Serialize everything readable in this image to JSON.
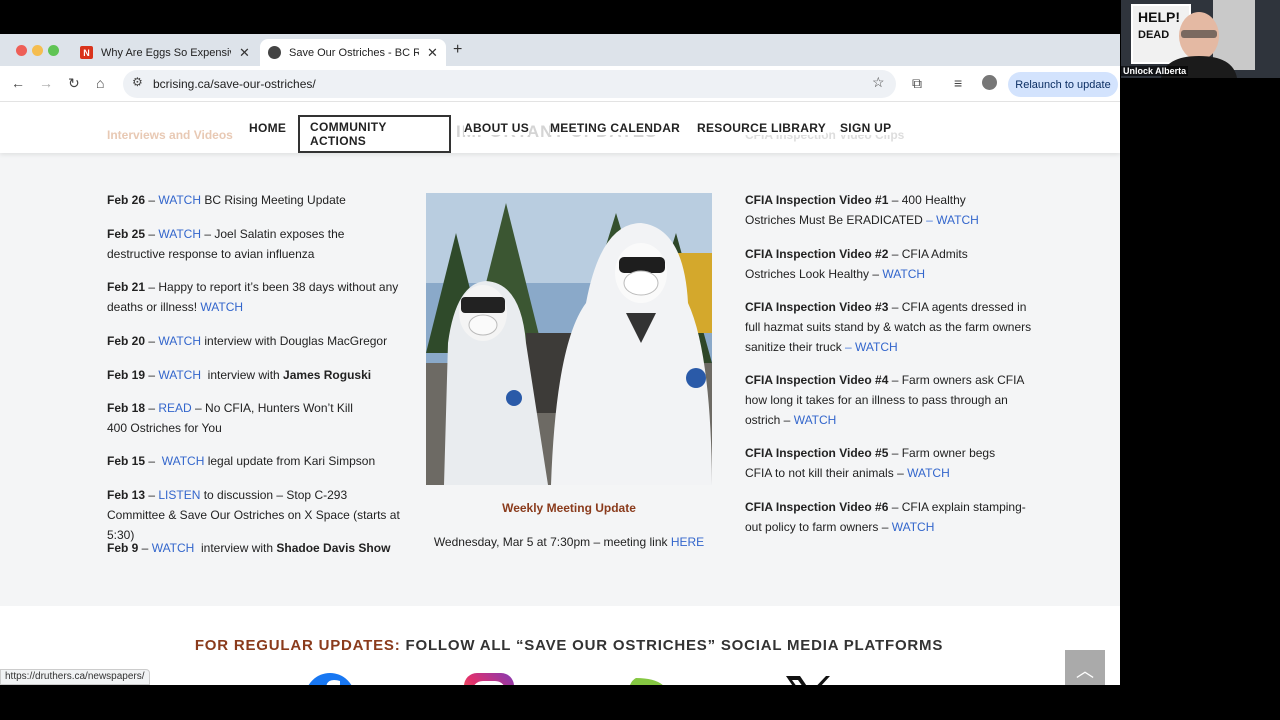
{
  "browser": {
    "tabs": [
      {
        "label": "Why Are Eggs So Expensive a",
        "favicon": "N"
      },
      {
        "label": "Save Our Ostriches - BC Risi",
        "favicon": ""
      }
    ],
    "url": "bcrising.ca/save-our-ostriches/",
    "relaunch_label": "Relaunch to update",
    "status_url": "https://druthers.ca/newspapers/"
  },
  "site_nav": {
    "ghost_left": "Interviews and Videos",
    "ghost_center": "IMPORTANT UPDATES",
    "ghost_right": "CFIA Inspection Video Clips",
    "items": [
      {
        "label": "HOME"
      },
      {
        "label": "COMMUNITY ACTIONS"
      },
      {
        "label": "ABOUT US"
      },
      {
        "label": "MEETING CALENDAR"
      },
      {
        "label": "RESOURCE LIBRARY"
      },
      {
        "label": "SIGN UP"
      }
    ]
  },
  "left_column": [
    {
      "date": "Feb 26",
      "sep": " – ",
      "link": "WATCH",
      "text": " BC Rising Meeting Update",
      "bold": ""
    },
    {
      "date": "Feb 25",
      "sep": " – ",
      "link": "WATCH",
      "text": " – Joel Salatin exposes the destructive response to avian influenza",
      "bold": ""
    },
    {
      "date": "Feb 21",
      "sep": " – ",
      "link": "",
      "text": "Happy to report it’s been 38 days without any deaths or illness! ",
      "link_after": "WATCH",
      "bold": ""
    },
    {
      "date": "Feb 20",
      "sep": " – ",
      "link": "WATCH",
      "text": " interview with Douglas MacGregor",
      "bold": ""
    },
    {
      "date": "Feb 19",
      "sep": " – ",
      "link": "WATCH",
      "text": "  interview with ",
      "bold": "James Roguski"
    },
    {
      "date": "Feb 18",
      "sep": " – ",
      "link": "READ",
      "text": " – No CFIA, Hunters Won’t Kill 400 Ostriches for You",
      "bold": ""
    },
    {
      "date": "Feb 15",
      "sep": " –  ",
      "link": "WATCH",
      "text": " legal update from Kari Simpson",
      "bold": ""
    },
    {
      "date": "Feb 13",
      "sep": " – ",
      "link": "LISTEN",
      "text": " to discussion – Stop C-293 Committee & Save Our Ostriches on X Space (starts at 5:30)",
      "bold": ""
    },
    {
      "date": "Feb 9",
      "sep": " – ",
      "link": "WATCH",
      "text": "  interview with ",
      "bold": "Shadoe Davis Show"
    }
  ],
  "center": {
    "weekly_title": "Weekly Meeting Update",
    "meeting_text": "Wednesday, Mar 5 at 7:30pm – meeting link ",
    "meeting_link": "HERE"
  },
  "right_column": [
    {
      "title": "CFIA Inspection Video #1",
      "text": " – 400 Healthy Ostriches Must Be ERADICATED",
      "sep": " – ",
      "link": "WATCH"
    },
    {
      "title": "CFIA Inspection Video #2",
      "text": " – CFIA Admits Ostriches Look Healthy",
      "sep": " – ",
      "link": "WATCH"
    },
    {
      "title": "CFIA Inspection Video #3",
      "text": " – CFIA agents dressed in full hazmat suits stand by & watch as the farm owners sanitize their truck",
      "sep": " – ",
      "link": "WATCH"
    },
    {
      "title": "CFIA Inspection Video #4",
      "text": " – Farm owners ask CFIA how long it takes for an illness to pass through an ostrich",
      "sep": " – ",
      "link": "WATCH"
    },
    {
      "title": "CFIA Inspection Video #5",
      "text": " – Farm owner begs CFIA to not kill their animals",
      "sep": " – ",
      "link": "WATCH"
    },
    {
      "title": "CFIA Inspection Video #6",
      "text": " – CFIA explain stamping-out policy to farm owners",
      "sep": " – ",
      "link": "WATCH"
    }
  ],
  "footer": {
    "accent": "FOR REGULAR UPDATES:",
    "rest": " FOLLOW ALL “SAVE OUR OSTRICHES” SOCIAL MEDIA PLATFORMS",
    "platforms": [
      "facebook-icon",
      "instagram-icon",
      "rumble-icon",
      "x-icon"
    ]
  },
  "webcam": {
    "label": "Unlock Alberta",
    "sign_text": "HELP!"
  },
  "colors": {
    "accent_brown": "#8a3b1c",
    "link_blue": "#3366cc"
  }
}
